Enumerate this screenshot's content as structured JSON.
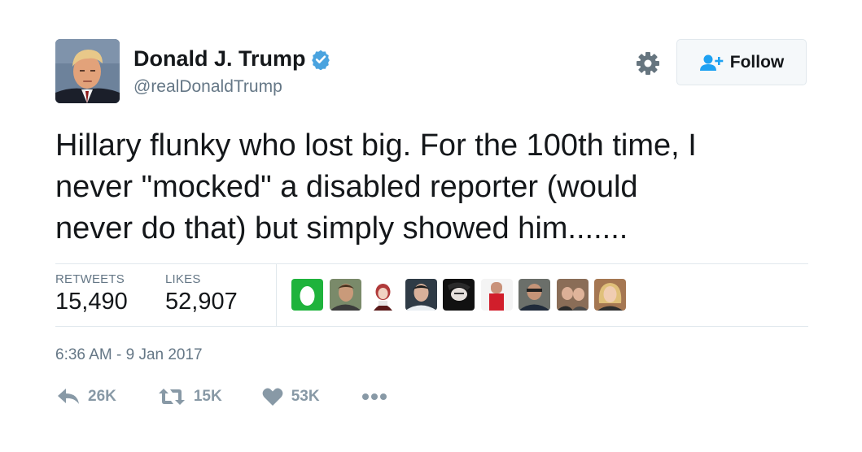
{
  "user": {
    "display_name": "Donald J. Trump",
    "handle": "@realDonaldTrump",
    "verified_icon": "verified-badge-icon",
    "verified_color": "#4aa3df"
  },
  "follow_button": {
    "label": "Follow",
    "icon": "add-user-icon",
    "icon_color": "#1da1f2"
  },
  "tweet": {
    "lines": [
      "Hillary flunky who lost big. For the 100th time, I",
      "never \"mocked\" a disabled reporter (would",
      "never do that) but simply showed him......."
    ]
  },
  "stats": {
    "retweets_label": "RETWEETS",
    "retweets_value": "15,490",
    "likes_label": "LIKES",
    "likes_value": "52,907"
  },
  "likers": [
    {
      "name": "egg-avatar"
    },
    {
      "name": "liker-avatar-2"
    },
    {
      "name": "liker-avatar-3"
    },
    {
      "name": "liker-avatar-4"
    },
    {
      "name": "liker-avatar-5"
    },
    {
      "name": "liker-avatar-6"
    },
    {
      "name": "liker-avatar-7"
    },
    {
      "name": "liker-avatar-8"
    },
    {
      "name": "liker-avatar-9"
    }
  ],
  "timestamp": "6:36 AM - 9 Jan 2017",
  "actions": {
    "reply_count": "26K",
    "retweet_count": "15K",
    "like_count": "53K",
    "icon_color": "#8899a6"
  }
}
